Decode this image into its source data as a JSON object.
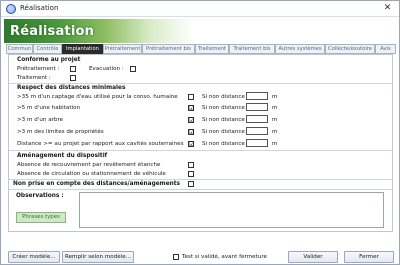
{
  "window": {
    "title": "Réalisation",
    "close_glyph": "✕"
  },
  "banner": {
    "title": "Réalisation"
  },
  "tabs": [
    "Commun",
    "Contrôle",
    "Implantation",
    "Prétraitement",
    "Prétraitement bis",
    "Traitement",
    "Traitement bis",
    "Autres systèmes",
    "Collecte/exutoire",
    "Avis"
  ],
  "active_tab": "Implantation",
  "sections": {
    "conformite": {
      "title": "Conforme au projet",
      "pretraitement": "Prétraitement :",
      "evacuation": "Evacuation :",
      "traitement": "Traitement :"
    },
    "distances": {
      "title": "Respect des distances minimales",
      "rows": [
        {
          "label": ">35 m d'un captage d'eau utilisé pour la conso. humaine",
          "checked": false,
          "si_non": "Si non distance",
          "unit": "m"
        },
        {
          "label": ">5 m d'une habitation",
          "checked": true,
          "si_non": "Si non distance",
          "unit": "m"
        },
        {
          "label": ">3 m d'un arbre",
          "checked": true,
          "si_non": "Si non distance",
          "unit": "m"
        },
        {
          "label": ">3 m des limites de propriétés",
          "checked": true,
          "si_non": "Si non distance",
          "unit": "m"
        },
        {
          "label": "Distance >= au projet par rapport aux cavités souterraines",
          "checked": true,
          "si_non": "Si non distance",
          "unit": "m"
        }
      ]
    },
    "amenagement": {
      "title": "Aménagement du dispositif",
      "rows": [
        {
          "label": "Absence de recouvrement par revêtement étanche",
          "checked": false
        },
        {
          "label": "Absence de circulation ou stationnement de véhicule",
          "checked": false
        }
      ]
    },
    "non_prise": {
      "label": "Non prise en compte des distances/aménagements",
      "checked": false
    },
    "observations": {
      "label": "Observations :",
      "phrases_button": "Phrases types",
      "value": ""
    }
  },
  "footer": {
    "creer_modele": "Créer modèle...",
    "remplir_modele": "Remplir selon modèle...",
    "test_label": "Test si validé, avant fermeture",
    "test_checked": false,
    "valider": "Valider",
    "fermer": "Fermer"
  },
  "check_glyph": "☑",
  "colors": {
    "banner_green": "#4a9a3c",
    "active_tab": "#2b2b2b",
    "phrases_button_bg": "#cfe9c4"
  }
}
